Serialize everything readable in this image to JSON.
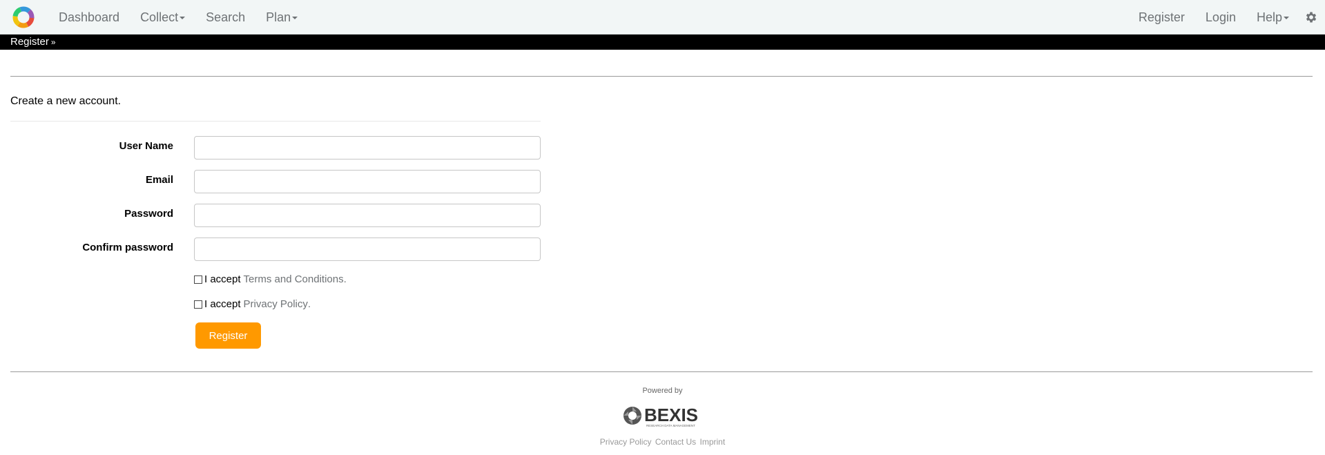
{
  "navbar": {
    "logo_icon": "bexis-color-ring-logo",
    "left_items": [
      {
        "label": "Dashboard",
        "dropdown": false
      },
      {
        "label": "Collect",
        "dropdown": true
      },
      {
        "label": "Search",
        "dropdown": false
      },
      {
        "label": "Plan",
        "dropdown": true
      }
    ],
    "right_items": [
      {
        "label": "Register",
        "dropdown": false
      },
      {
        "label": "Login",
        "dropdown": false
      },
      {
        "label": "Help",
        "dropdown": true
      }
    ],
    "settings_icon": "gear-icon"
  },
  "breadcrumb": {
    "label": "Register",
    "icon": "double-chevron-down-icon"
  },
  "form": {
    "subtitle": "Create a new account.",
    "fields": [
      {
        "label": "User Name",
        "value": "",
        "type": "text"
      },
      {
        "label": "Email",
        "value": "",
        "type": "email"
      },
      {
        "label": "Password",
        "value": "",
        "type": "password"
      },
      {
        "label": "Confirm password",
        "value": "",
        "type": "password"
      }
    ],
    "terms": {
      "prefix": "I accept",
      "link": "Terms and Conditions",
      "suffix": ".",
      "checked": false
    },
    "privacy": {
      "prefix": "I accept",
      "link": "Privacy Policy",
      "suffix": ".",
      "checked": false
    },
    "submit_label": "Register"
  },
  "footer": {
    "powered_by": "Powered by",
    "brand": "BEXIS",
    "brand_tagline": "RESEARCH DATA MANAGEMENT",
    "links": [
      "Privacy Policy",
      "Contact Us",
      "Imprint"
    ]
  },
  "colors": {
    "navbar_bg": "#f2f6f6",
    "nav_text": "#6e7275",
    "breadcrumb_bg": "#000000",
    "accent": "#ff9900"
  }
}
